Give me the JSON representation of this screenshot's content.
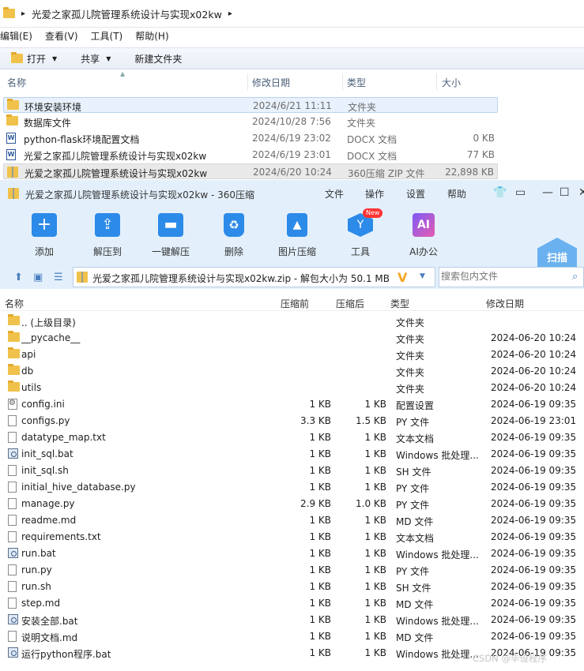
{
  "explorer": {
    "path": "光爱之家孤儿院管理系统设计与实现x02kw",
    "menu": [
      "编辑(E)",
      "查看(V)",
      "工具(T)",
      "帮助(H)"
    ],
    "toolbar": {
      "open": "打开",
      "share": "共享",
      "new_folder": "新建文件夹"
    },
    "columns": {
      "name": "名称",
      "date": "修改日期",
      "type": "类型",
      "size": "大小"
    },
    "rows": [
      {
        "name": "环境安装环境",
        "date": "2024/6/21 11:11",
        "type": "文件夹",
        "size": "",
        "icon": "folder-icon"
      },
      {
        "name": "数据库文件",
        "date": "2024/10/28 7:56",
        "type": "文件夹",
        "size": "",
        "icon": "folder-icon"
      },
      {
        "name": "python-flask环境配置文档",
        "date": "2024/6/19 23:02",
        "type": "DOCX 文档",
        "size": "0 KB",
        "icon": "word-icon"
      },
      {
        "name": "光爱之家孤儿院管理系统设计与实现x02kw",
        "date": "2024/6/19 23:01",
        "type": "DOCX 文档",
        "size": "77 KB",
        "icon": "word-icon"
      },
      {
        "name": "光爱之家孤儿院管理系统设计与实现x02kw",
        "date": "2024/6/20 10:24",
        "type": "360压缩 ZIP 文件",
        "size": "22,898 KB",
        "icon": "zip-icon"
      }
    ]
  },
  "zip": {
    "title": "光爱之家孤儿院管理系统设计与实现x02kw - 360压缩",
    "menu": [
      "文件",
      "操作",
      "设置",
      "帮助"
    ],
    "ribbon": [
      "添加",
      "解压到",
      "一键解压",
      "删除",
      "图片压缩",
      "工具",
      "AI办公"
    ],
    "new_badge": "New",
    "ai_text": "AI",
    "scan": "扫描",
    "address": "光爱之家孤儿院管理系统设计与实现x02kw.zip - 解包大小为 50.1 MB",
    "search_placeholder": "搜索包内文件",
    "columns": {
      "name": "名称",
      "csize": "压缩前",
      "asize": "压缩后",
      "type": "类型",
      "date": "修改日期"
    },
    "rows": [
      {
        "name": ".. (上级目录)",
        "csize": "",
        "asize": "",
        "type": "文件夹",
        "date": "",
        "icon": "folder-icon"
      },
      {
        "name": "__pycache__",
        "csize": "",
        "asize": "",
        "type": "文件夹",
        "date": "2024-06-20 10:24",
        "icon": "folder-icon"
      },
      {
        "name": "api",
        "csize": "",
        "asize": "",
        "type": "文件夹",
        "date": "2024-06-20 10:24",
        "icon": "folder-icon"
      },
      {
        "name": "db",
        "csize": "",
        "asize": "",
        "type": "文件夹",
        "date": "2024-06-20 10:24",
        "icon": "folder-icon"
      },
      {
        "name": "utils",
        "csize": "",
        "asize": "",
        "type": "文件夹",
        "date": "2024-06-20 10:24",
        "icon": "folder-icon"
      },
      {
        "name": "config.ini",
        "csize": "1 KB",
        "asize": "1 KB",
        "type": "配置设置",
        "date": "2024-06-19 09:35",
        "icon": "settings-file-icon"
      },
      {
        "name": "configs.py",
        "csize": "3.3 KB",
        "asize": "1.5 KB",
        "type": "PY 文件",
        "date": "2024-06-19 23:01",
        "icon": "file-icon"
      },
      {
        "name": "datatype_map.txt",
        "csize": "1 KB",
        "asize": "1 KB",
        "type": "文本文档",
        "date": "2024-06-19 09:35",
        "icon": "file-icon"
      },
      {
        "name": "init_sql.bat",
        "csize": "1 KB",
        "asize": "1 KB",
        "type": "Windows 批处理...",
        "date": "2024-06-19 09:35",
        "icon": "batch-file-icon"
      },
      {
        "name": "init_sql.sh",
        "csize": "1 KB",
        "asize": "1 KB",
        "type": "SH 文件",
        "date": "2024-06-19 09:35",
        "icon": "file-icon"
      },
      {
        "name": "initial_hive_database.py",
        "csize": "1 KB",
        "asize": "1 KB",
        "type": "PY 文件",
        "date": "2024-06-19 09:35",
        "icon": "file-icon"
      },
      {
        "name": "manage.py",
        "csize": "2.9 KB",
        "asize": "1.0 KB",
        "type": "PY 文件",
        "date": "2024-06-19 09:35",
        "icon": "file-icon"
      },
      {
        "name": "readme.md",
        "csize": "1 KB",
        "asize": "1 KB",
        "type": "MD 文件",
        "date": "2024-06-19 09:35",
        "icon": "file-icon"
      },
      {
        "name": "requirements.txt",
        "csize": "1 KB",
        "asize": "1 KB",
        "type": "文本文档",
        "date": "2024-06-19 09:35",
        "icon": "file-icon"
      },
      {
        "name": "run.bat",
        "csize": "1 KB",
        "asize": "1 KB",
        "type": "Windows 批处理...",
        "date": "2024-06-19 09:35",
        "icon": "batch-file-icon"
      },
      {
        "name": "run.py",
        "csize": "1 KB",
        "asize": "1 KB",
        "type": "PY 文件",
        "date": "2024-06-19 09:35",
        "icon": "file-icon"
      },
      {
        "name": "run.sh",
        "csize": "1 KB",
        "asize": "1 KB",
        "type": "SH 文件",
        "date": "2024-06-19 09:35",
        "icon": "file-icon"
      },
      {
        "name": "step.md",
        "csize": "1 KB",
        "asize": "1 KB",
        "type": "MD 文件",
        "date": "2024-06-19 09:35",
        "icon": "file-icon"
      },
      {
        "name": "安装全部.bat",
        "csize": "1 KB",
        "asize": "1 KB",
        "type": "Windows 批处理...",
        "date": "2024-06-19 09:35",
        "icon": "batch-file-icon"
      },
      {
        "name": "说明文档.md",
        "csize": "1 KB",
        "asize": "1 KB",
        "type": "MD 文件",
        "date": "2024-06-19 09:35",
        "icon": "file-icon"
      },
      {
        "name": "运行python程序.bat",
        "csize": "1 KB",
        "asize": "1 KB",
        "type": "Windows 批处理...",
        "date": "2024-06-19 09:35",
        "icon": "batch-file-icon"
      }
    ]
  },
  "watermark": "CSDN @毕设程序"
}
